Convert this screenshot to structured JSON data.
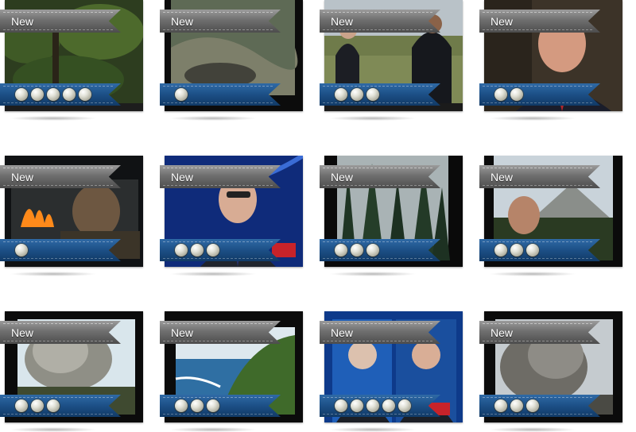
{
  "badge_text": "New",
  "items": [
    {
      "badge": "New",
      "coins": 5,
      "scene": "jungle"
    },
    {
      "badge": "New",
      "coins": 1,
      "scene": "grass"
    },
    {
      "badge": "New",
      "coins": 3,
      "scene": "field"
    },
    {
      "badge": "New",
      "coins": 2,
      "scene": "interview"
    },
    {
      "badge": "New",
      "coins": 1,
      "scene": "fire"
    },
    {
      "badge": "New",
      "coins": 3,
      "scene": "studio"
    },
    {
      "badge": "New",
      "coins": 3,
      "scene": "forest"
    },
    {
      "badge": "New",
      "coins": 3,
      "scene": "mountain"
    },
    {
      "badge": "New",
      "coins": 3,
      "scene": "eruption"
    },
    {
      "badge": "New",
      "coins": 3,
      "scene": "coast"
    },
    {
      "badge": "New",
      "coins": 5,
      "scene": "split"
    },
    {
      "badge": "New",
      "coins": 3,
      "scene": "ash"
    }
  ],
  "colors": {
    "ribbon_top": "#6f6f6f",
    "ribbon_bottom": "#1c4f86",
    "coin": "#d8d8cc"
  }
}
